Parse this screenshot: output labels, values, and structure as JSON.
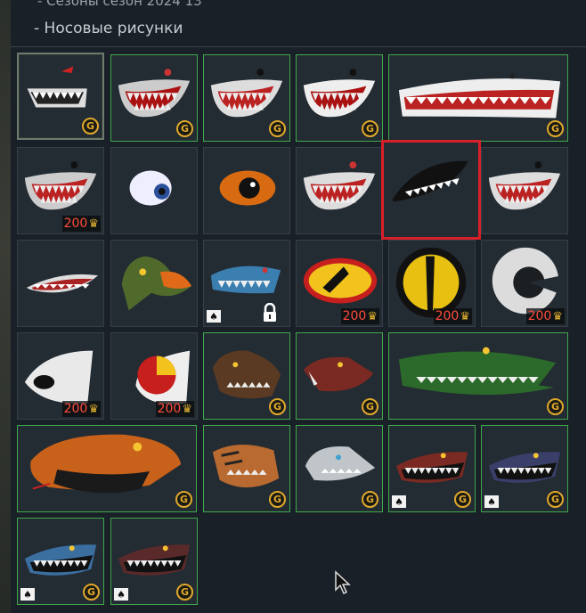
{
  "section": {
    "previous_label": "- Сезоны сезон 2024 13",
    "title": "- Носовые рисунки"
  },
  "currency": {
    "gold_symbol": "G",
    "eagle_symbol": "♛",
    "spade_symbol": "♠"
  },
  "tiles": [
    {
      "name": "tile-shark-mouth-1",
      "badge": "gold",
      "price": ""
    },
    {
      "name": "tile-shark-mouth-2",
      "badge": "gold",
      "price": ""
    },
    {
      "name": "tile-shark-mouth-3",
      "badge": "gold",
      "price": ""
    },
    {
      "name": "tile-shark-mouth-4",
      "badge": "gold",
      "price": ""
    },
    {
      "name": "tile-shark-mouth-wide",
      "badge": "gold",
      "price": ""
    },
    {
      "name": "tile-shark-mouth-5",
      "badge": "price",
      "price": "200"
    },
    {
      "name": "tile-eye-blue",
      "badge": "none",
      "price": ""
    },
    {
      "name": "tile-eye-orange",
      "badge": "none",
      "price": ""
    },
    {
      "name": "tile-shark-mouth-6",
      "badge": "none",
      "price": ""
    },
    {
      "name": "tile-shark-mouth-black",
      "badge": "none",
      "price": ""
    },
    {
      "name": "tile-shark-mouth-7",
      "badge": "none",
      "price": ""
    },
    {
      "name": "tile-mouth-red",
      "badge": "none",
      "price": ""
    },
    {
      "name": "tile-eagle-head",
      "badge": "none",
      "price": ""
    },
    {
      "name": "tile-blue-shark",
      "badge": "spade-lock",
      "price": ""
    },
    {
      "name": "tile-eye-yellow-red",
      "badge": "price",
      "price": "200"
    },
    {
      "name": "tile-eye-yellow",
      "badge": "price",
      "price": "200"
    },
    {
      "name": "tile-eye-white",
      "badge": "price",
      "price": "200"
    },
    {
      "name": "tile-eye-white-2",
      "badge": "price",
      "price": "200"
    },
    {
      "name": "tile-eye-red-yellow",
      "badge": "price",
      "price": "200"
    },
    {
      "name": "tile-bear",
      "badge": "gold",
      "price": ""
    },
    {
      "name": "tile-boar",
      "badge": "gold",
      "price": ""
    },
    {
      "name": "tile-crocodile",
      "badge": "gold",
      "price": ""
    },
    {
      "name": "tile-snake",
      "badge": "gold",
      "price": ""
    },
    {
      "name": "tile-tiger",
      "badge": "gold",
      "price": ""
    },
    {
      "name": "tile-wolf",
      "badge": "gold",
      "price": ""
    },
    {
      "name": "tile-dark-shark-1",
      "badge": "spade-gold",
      "price": ""
    },
    {
      "name": "tile-dark-shark-2",
      "badge": "spade-gold",
      "price": ""
    },
    {
      "name": "tile-dark-shark-3",
      "badge": "spade-gold",
      "price": ""
    },
    {
      "name": "tile-dark-shark-4",
      "badge": "spade-gold",
      "price": ""
    }
  ]
}
